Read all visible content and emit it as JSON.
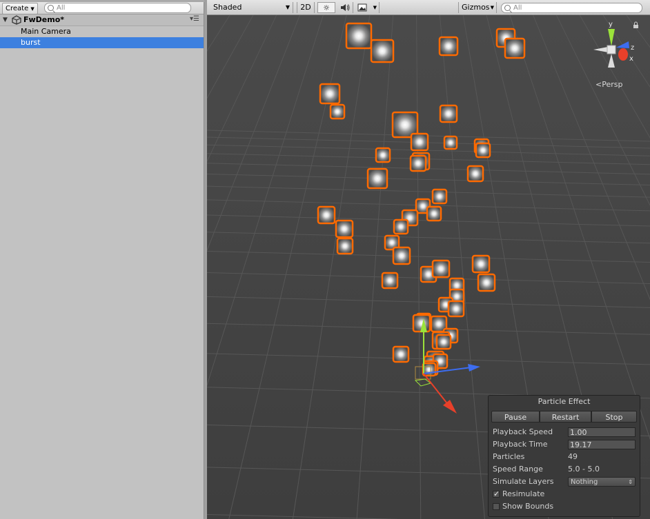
{
  "hierarchy": {
    "create_label": "Create",
    "search_placeholder": "All",
    "scene_name": "FwDemo*",
    "items": [
      {
        "label": "Main Camera",
        "selected": false
      },
      {
        "label": "burst",
        "selected": true
      }
    ]
  },
  "scene_toolbar": {
    "shading_mode": "Shaded",
    "mode_2d": "2D",
    "gizmos_label": "Gizmos",
    "search_placeholder": "All"
  },
  "orientation_gizmo": {
    "axis_y": "y",
    "axis_z": "z",
    "axis_x": "x",
    "projection": "Persp"
  },
  "particle_effect": {
    "title": "Particle Effect",
    "buttons": {
      "pause": "Pause",
      "restart": "Restart",
      "stop": "Stop"
    },
    "playback_speed_label": "Playback Speed",
    "playback_speed": "1.00",
    "playback_time_label": "Playback Time",
    "playback_time": "19.17",
    "particles_label": "Particles",
    "particles": "49",
    "speed_range_label": "Speed Range",
    "speed_range": "5.0 - 5.0",
    "simulate_layers_label": "Simulate Layers",
    "simulate_layers": "Nothing",
    "resimulate_label": "Resimulate",
    "resimulate": true,
    "show_bounds_label": "Show Bounds",
    "show_bounds": false
  },
  "colors": {
    "selection_blue": "#3d80df",
    "particle_outline": "#ff6a00",
    "viewport_bg": "#444444",
    "axis_y": "#9be33a",
    "axis_z": "#3d6df0",
    "axis_x": "#e8402a"
  }
}
